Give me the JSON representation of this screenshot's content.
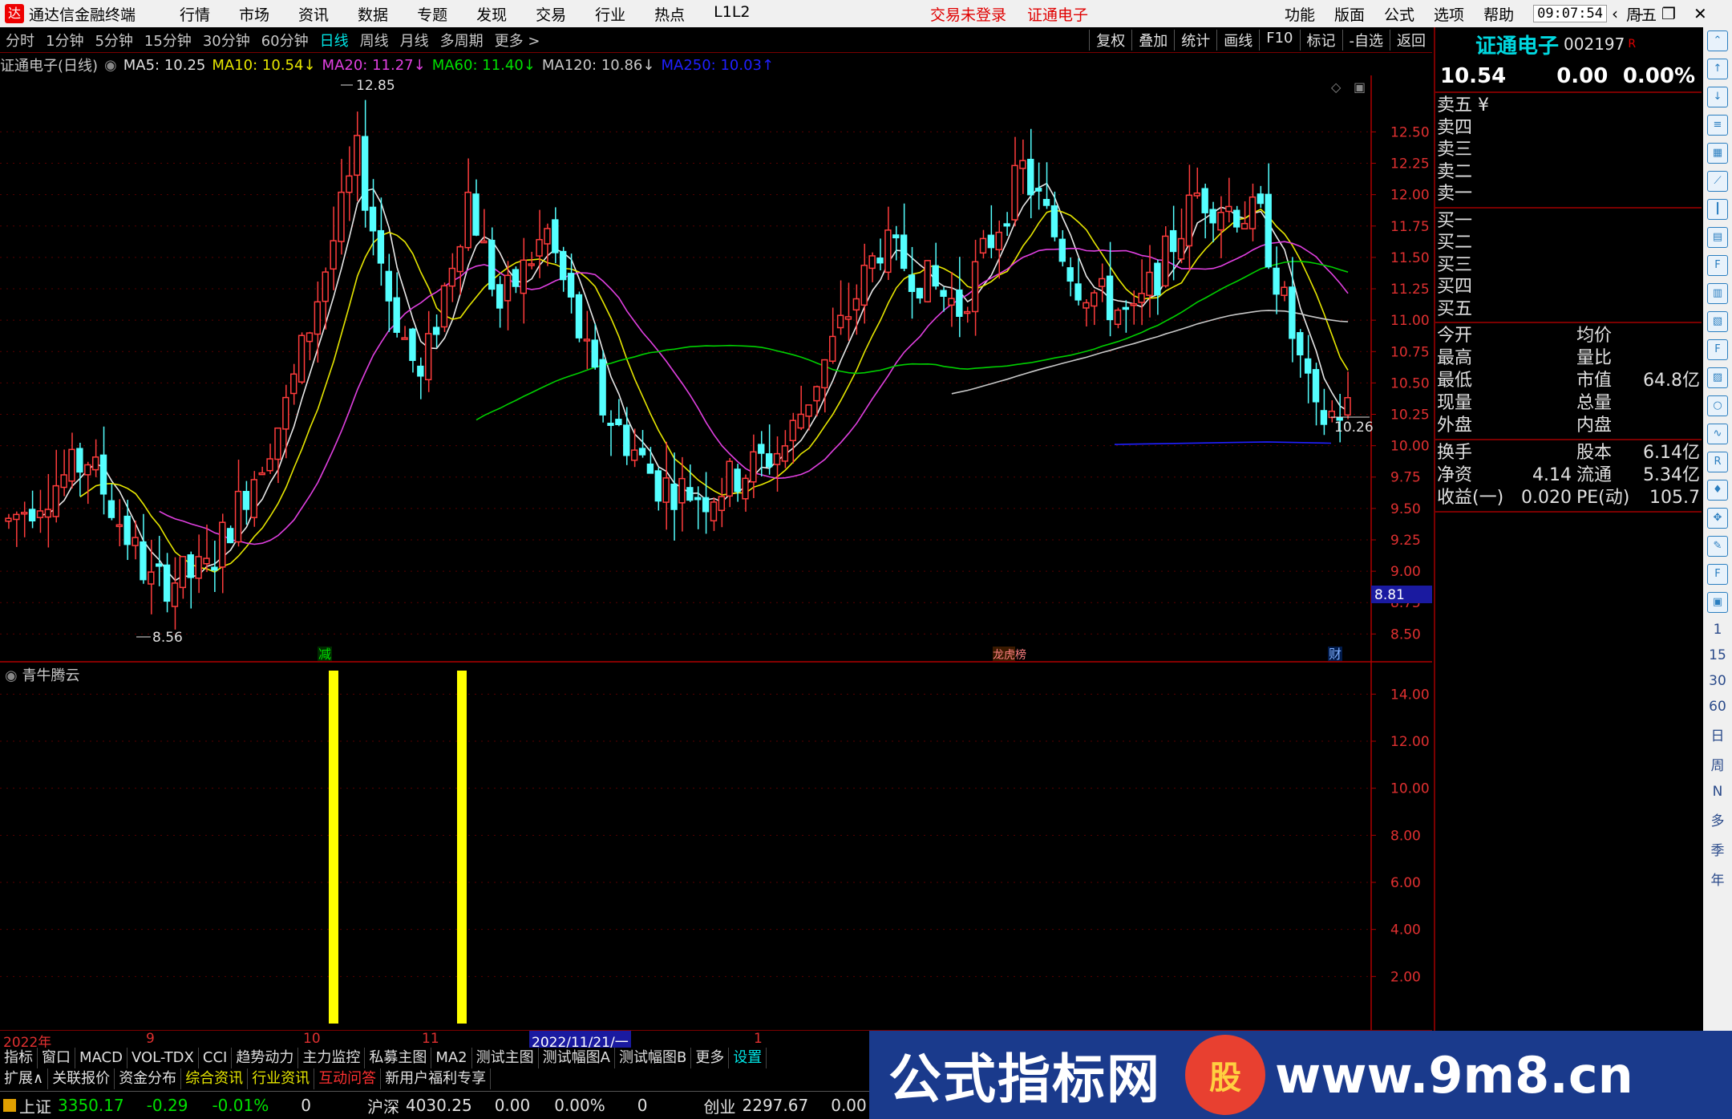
{
  "titlebar": {
    "app_title": "通达信金融终端",
    "menu": [
      "行情",
      "市场",
      "资讯",
      "数据",
      "专题",
      "发现",
      "交易",
      "行业",
      "热点",
      "L1L2"
    ],
    "center": [
      "交易未登录",
      "证通电子"
    ],
    "right": [
      "功能",
      "版面",
      "公式",
      "选项",
      "帮助"
    ],
    "clock": "09:07:54",
    "weekday": "周五"
  },
  "periods": [
    "分时",
    "1分钟",
    "5分钟",
    "15分钟",
    "30分钟",
    "60分钟",
    "日线",
    "周线",
    "月线",
    "多周期",
    "更多 >"
  ],
  "active_period": "日线",
  "tools": [
    "复权",
    "叠加",
    "统计",
    "画线",
    "F10",
    "标记",
    "-自选",
    "返回"
  ],
  "chart_title": {
    "stock": "证通电子(日线)",
    "ma5": "MA5: 10.25",
    "ma10": "MA10: 10.54↓",
    "ma20": "MA20: 11.27↓",
    "ma60": "MA60: 11.40↓",
    "ma120": "MA120: 10.86↓",
    "ma250": "MA250: 10.03↑"
  },
  "chart_data": {
    "type": "candlestick",
    "yaxis_ticks": [
      "12.50",
      "12.25",
      "12.00",
      "11.75",
      "11.50",
      "11.25",
      "11.00",
      "10.75",
      "10.50",
      "10.25",
      "10.00",
      "9.75",
      "9.50",
      "9.25",
      "9.00",
      "8.75",
      "8.50"
    ],
    "ylim": [
      8.4,
      12.95
    ],
    "high_label": "12.85",
    "low_label": "8.56",
    "last_label": "10.26",
    "cursor_price": "8.81",
    "event_markers": [
      "减",
      "龙虎榜",
      "财"
    ],
    "indicator": {
      "name": "青牛腾云",
      "yaxis_ticks": [
        "14.00",
        "12.00",
        "10.00",
        "8.00",
        "6.00",
        "4.00",
        "2.00"
      ],
      "ylim": [
        0,
        15
      ],
      "bars": [
        15,
        15
      ]
    },
    "time_labels": [
      "2022年",
      "9",
      "10",
      "11",
      "2022/11/21/一",
      "1"
    ]
  },
  "tabs_row1": [
    "指标",
    "窗口",
    "MACD",
    "VOL-TDX",
    "CCI",
    "趋势动力",
    "主力监控",
    "私募主图",
    "MA2",
    "测试主图",
    "测试幅图A",
    "测试幅图B",
    "更多",
    "设置"
  ],
  "tabs_row2": [
    "扩展∧",
    "关联报价",
    "资金分布",
    "综合资讯",
    "行业资讯",
    "互动问答",
    "新用户福利专享"
  ],
  "quote": {
    "name": "证通电子",
    "code": "002197",
    "badge": "R",
    "price": "10.54",
    "change": "0.00",
    "pct": "0.00%",
    "asks": [
      "卖五 ¥",
      "卖四",
      "卖三",
      "卖二",
      "卖一"
    ],
    "bids": [
      "买一",
      "买二",
      "买三",
      "买四",
      "买五"
    ],
    "stats1": [
      {
        "k1": "今开",
        "v1": "",
        "k2": "均价",
        "v2": ""
      },
      {
        "k1": "最高",
        "v1": "",
        "k2": "量比",
        "v2": ""
      },
      {
        "k1": "最低",
        "v1": "",
        "k2": "市值",
        "v2": "64.8亿"
      },
      {
        "k1": "现量",
        "v1": "",
        "k2": "总量",
        "v2": ""
      },
      {
        "k1": "外盘",
        "v1": "",
        "k2": "内盘",
        "v2": ""
      }
    ],
    "stats2": [
      {
        "k1": "换手",
        "v1": "",
        "k2": "股本",
        "v2": "6.14亿"
      },
      {
        "k1": "净资",
        "v1": "4.14",
        "k2": "流通",
        "v2": "5.34亿"
      },
      {
        "k1": "收益(一)",
        "v1": "0.020",
        "k2": "PE(动)",
        "v2": "105.7"
      }
    ]
  },
  "rtool_text": [
    "1",
    "15",
    "30",
    "60",
    "日",
    "周",
    "N",
    "多",
    "季",
    "年"
  ],
  "status": {
    "sh_label": "上证",
    "sh_val": "3350.17",
    "sh_chg": "-0.29",
    "sh_pct": "-0.01%",
    "sh_vol": "0",
    "hs_label": "沪深",
    "hs_val": "4030.25",
    "hs_chg": "0.00",
    "hs_pct": "0.00%",
    "hs_vol": "0",
    "cy_label": "创业",
    "cy_val": "2297.67",
    "cy_chg": "0.00"
  },
  "banner": {
    "title": "公式指标网",
    "seal": "股",
    "url": "www.9m8.cn"
  }
}
